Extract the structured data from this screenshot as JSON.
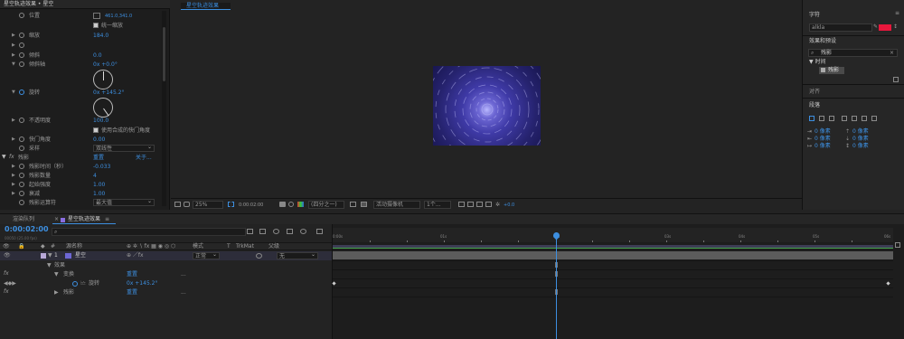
{
  "effect_controls": {
    "header": "星空轨迹效果 • 星空",
    "position": {
      "label": "位置",
      "value": "461.0,341.0"
    },
    "uniform_scale": "统一缩放",
    "scale": {
      "label": "缩放",
      "value": "184.0"
    },
    "skew": {
      "label": "倾斜",
      "value": "0.0"
    },
    "skew_axis": {
      "label": "倾斜轴",
      "value": "0x +0.0°"
    },
    "rotation": {
      "label": "旋转",
      "value": "0x +145.2°"
    },
    "opacity": {
      "label": "不透明度",
      "value": "100.0"
    },
    "use_comp_shutter": "使用合成的快门角度",
    "shutter_angle": {
      "label": "快门角度",
      "value": "0.00"
    },
    "sampling": {
      "label": "采样",
      "value": "双线性"
    },
    "echo": {
      "fx": "fx",
      "label": "残影",
      "reset": "重置",
      "about": "关于..."
    },
    "echo_time": {
      "label": "残影时间（秒）",
      "value": "-0.033"
    },
    "echo_count": {
      "label": "残影数量",
      "value": "4"
    },
    "start_intensity": {
      "label": "起始强度",
      "value": "1.00"
    },
    "decay": {
      "label": "衰减",
      "value": "1.00"
    },
    "echo_operator": {
      "label": "残影运算符",
      "value": "最大值"
    }
  },
  "viewer": {
    "tab": "星空轨迹效果",
    "zoom": "25%",
    "timecode": "0:00:02:00",
    "resolution": "(四分之一)",
    "camera": "活动摄像机",
    "views": "1个...",
    "exposure": "+0.0"
  },
  "right": {
    "character_title": "字符",
    "font_name": "alkla",
    "effects_title": "效果和预设",
    "search_value": "残影",
    "category": "▼ 时间",
    "result": "残影",
    "align_title": "对齐",
    "paragraph_title": "段落",
    "indent_rows": [
      [
        "0 像素",
        "0 像素"
      ],
      [
        "0 像素",
        "0 像素"
      ],
      [
        "0 像素",
        "0 像素"
      ]
    ]
  },
  "timeline": {
    "tabs": [
      "渲染队列",
      "星空轨迹效果"
    ],
    "timecode": "0:00:02:00",
    "fps": "00050 (25.00 fps)",
    "columns": {
      "source": "源名称",
      "mode": "模式",
      "t": "T",
      "trkmat": "TrkMat",
      "parent": "父级"
    },
    "layer": {
      "index": "1",
      "name": "星空",
      "mode": "正常",
      "parent": "无"
    },
    "rows": {
      "effects": "效果",
      "transform": "变换",
      "transform_reset": "重置",
      "transform_dots": "...",
      "rotation": "旋转",
      "rotation_value": "0x +145.2°",
      "echo": "残影",
      "echo_reset": "重置",
      "echo_dots": "..."
    },
    "ruler": [
      "0:00s",
      "01s",
      "02s",
      "03s",
      "04s",
      "05s",
      "06s"
    ]
  }
}
